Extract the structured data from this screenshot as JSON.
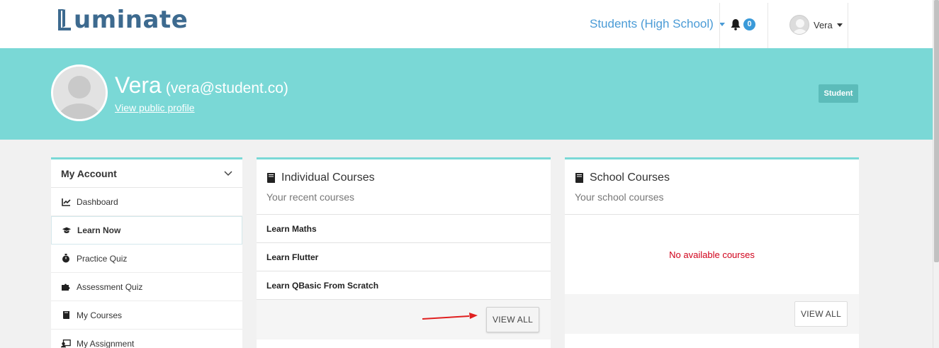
{
  "nav": {
    "logo_text": "uminate",
    "role_select": "Students (High School)",
    "notifications_count": "0",
    "user_name": "Vera"
  },
  "profile": {
    "name": "Vera",
    "email": "(vera@student.co)",
    "public_profile_link": "View public profile",
    "role_badge": "Student"
  },
  "sidebar": {
    "header": "My Account",
    "items": [
      {
        "label": "Dashboard",
        "icon": "chart-icon"
      },
      {
        "label": "Learn Now",
        "icon": "graduation-cap-icon"
      },
      {
        "label": "Practice Quiz",
        "icon": "stopwatch-icon"
      },
      {
        "label": "Assessment Quiz",
        "icon": "puzzle-icon"
      },
      {
        "label": "My Courses",
        "icon": "book-icon"
      },
      {
        "label": "My Assignment",
        "icon": "assignment-icon"
      }
    ]
  },
  "individual_courses": {
    "title": "Individual Courses",
    "subtitle": "Your recent courses",
    "courses": [
      "Learn Maths",
      "Learn Flutter",
      "Learn QBasic From Scratch"
    ],
    "view_all": "VIEW ALL"
  },
  "school_courses": {
    "title": "School Courses",
    "subtitle": "Your school courses",
    "empty_message": "No available courses",
    "view_all": "VIEW ALL"
  },
  "colors": {
    "banner": "#7ad8d6",
    "link_blue": "#4a9bd6",
    "logo": "#3d6a8f",
    "empty_red": "#d0021b",
    "annotation_arrow": "#e02020"
  }
}
